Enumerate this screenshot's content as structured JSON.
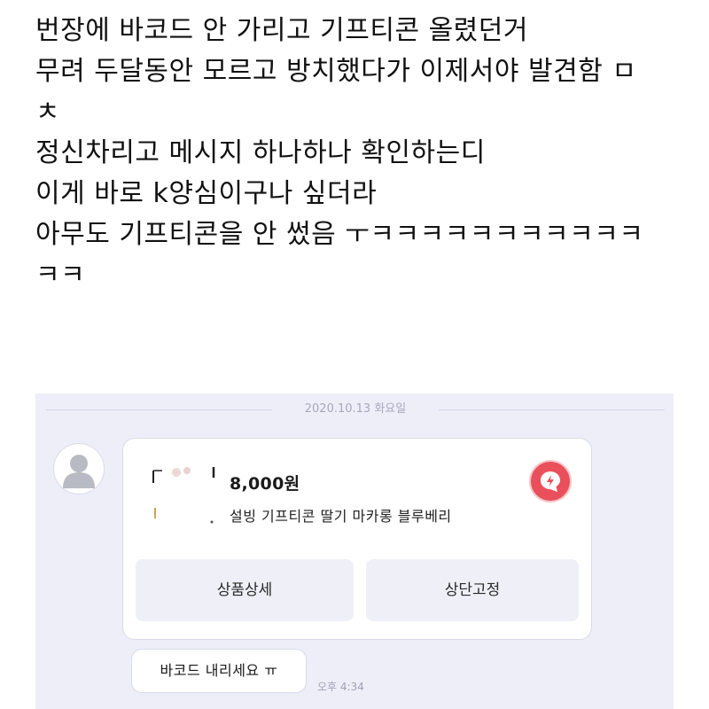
{
  "post": {
    "lines": [
      "번장에 바코드 안 가리고 기프티콘 올렸던거",
      "무려 두달동안 모르고 방치했다가 이제서야 발견함 ㅁ",
      "ㅊ",
      "정신차리고 메시지 하나하나 확인하는디",
      "이게 바로 k양심이구나 싶더라",
      "아무도 기프티콘을 안 썼음 ㅜㅋㅋㅋㅋㅋㅋㅋㅋㅋㅋㅋ",
      "ㅋㅋ"
    ]
  },
  "chat": {
    "date": "2020.10.13 화요일",
    "card": {
      "price": "8,000원",
      "product": "설빙 기프티콘 딸기 마카롱 블루베리",
      "detail_button": "상품상세",
      "pin_button": "상단고정"
    },
    "reply": "바코드 내리세요 ㅠ",
    "time": "오후 4:34"
  },
  "colors": {
    "chat_bg": "#edeef8",
    "alert_red": "#e9505b",
    "button_bg": "#eff0f7"
  },
  "icons": {
    "avatar": "default-person-avatar",
    "alert": "lightning-bubble-icon"
  }
}
